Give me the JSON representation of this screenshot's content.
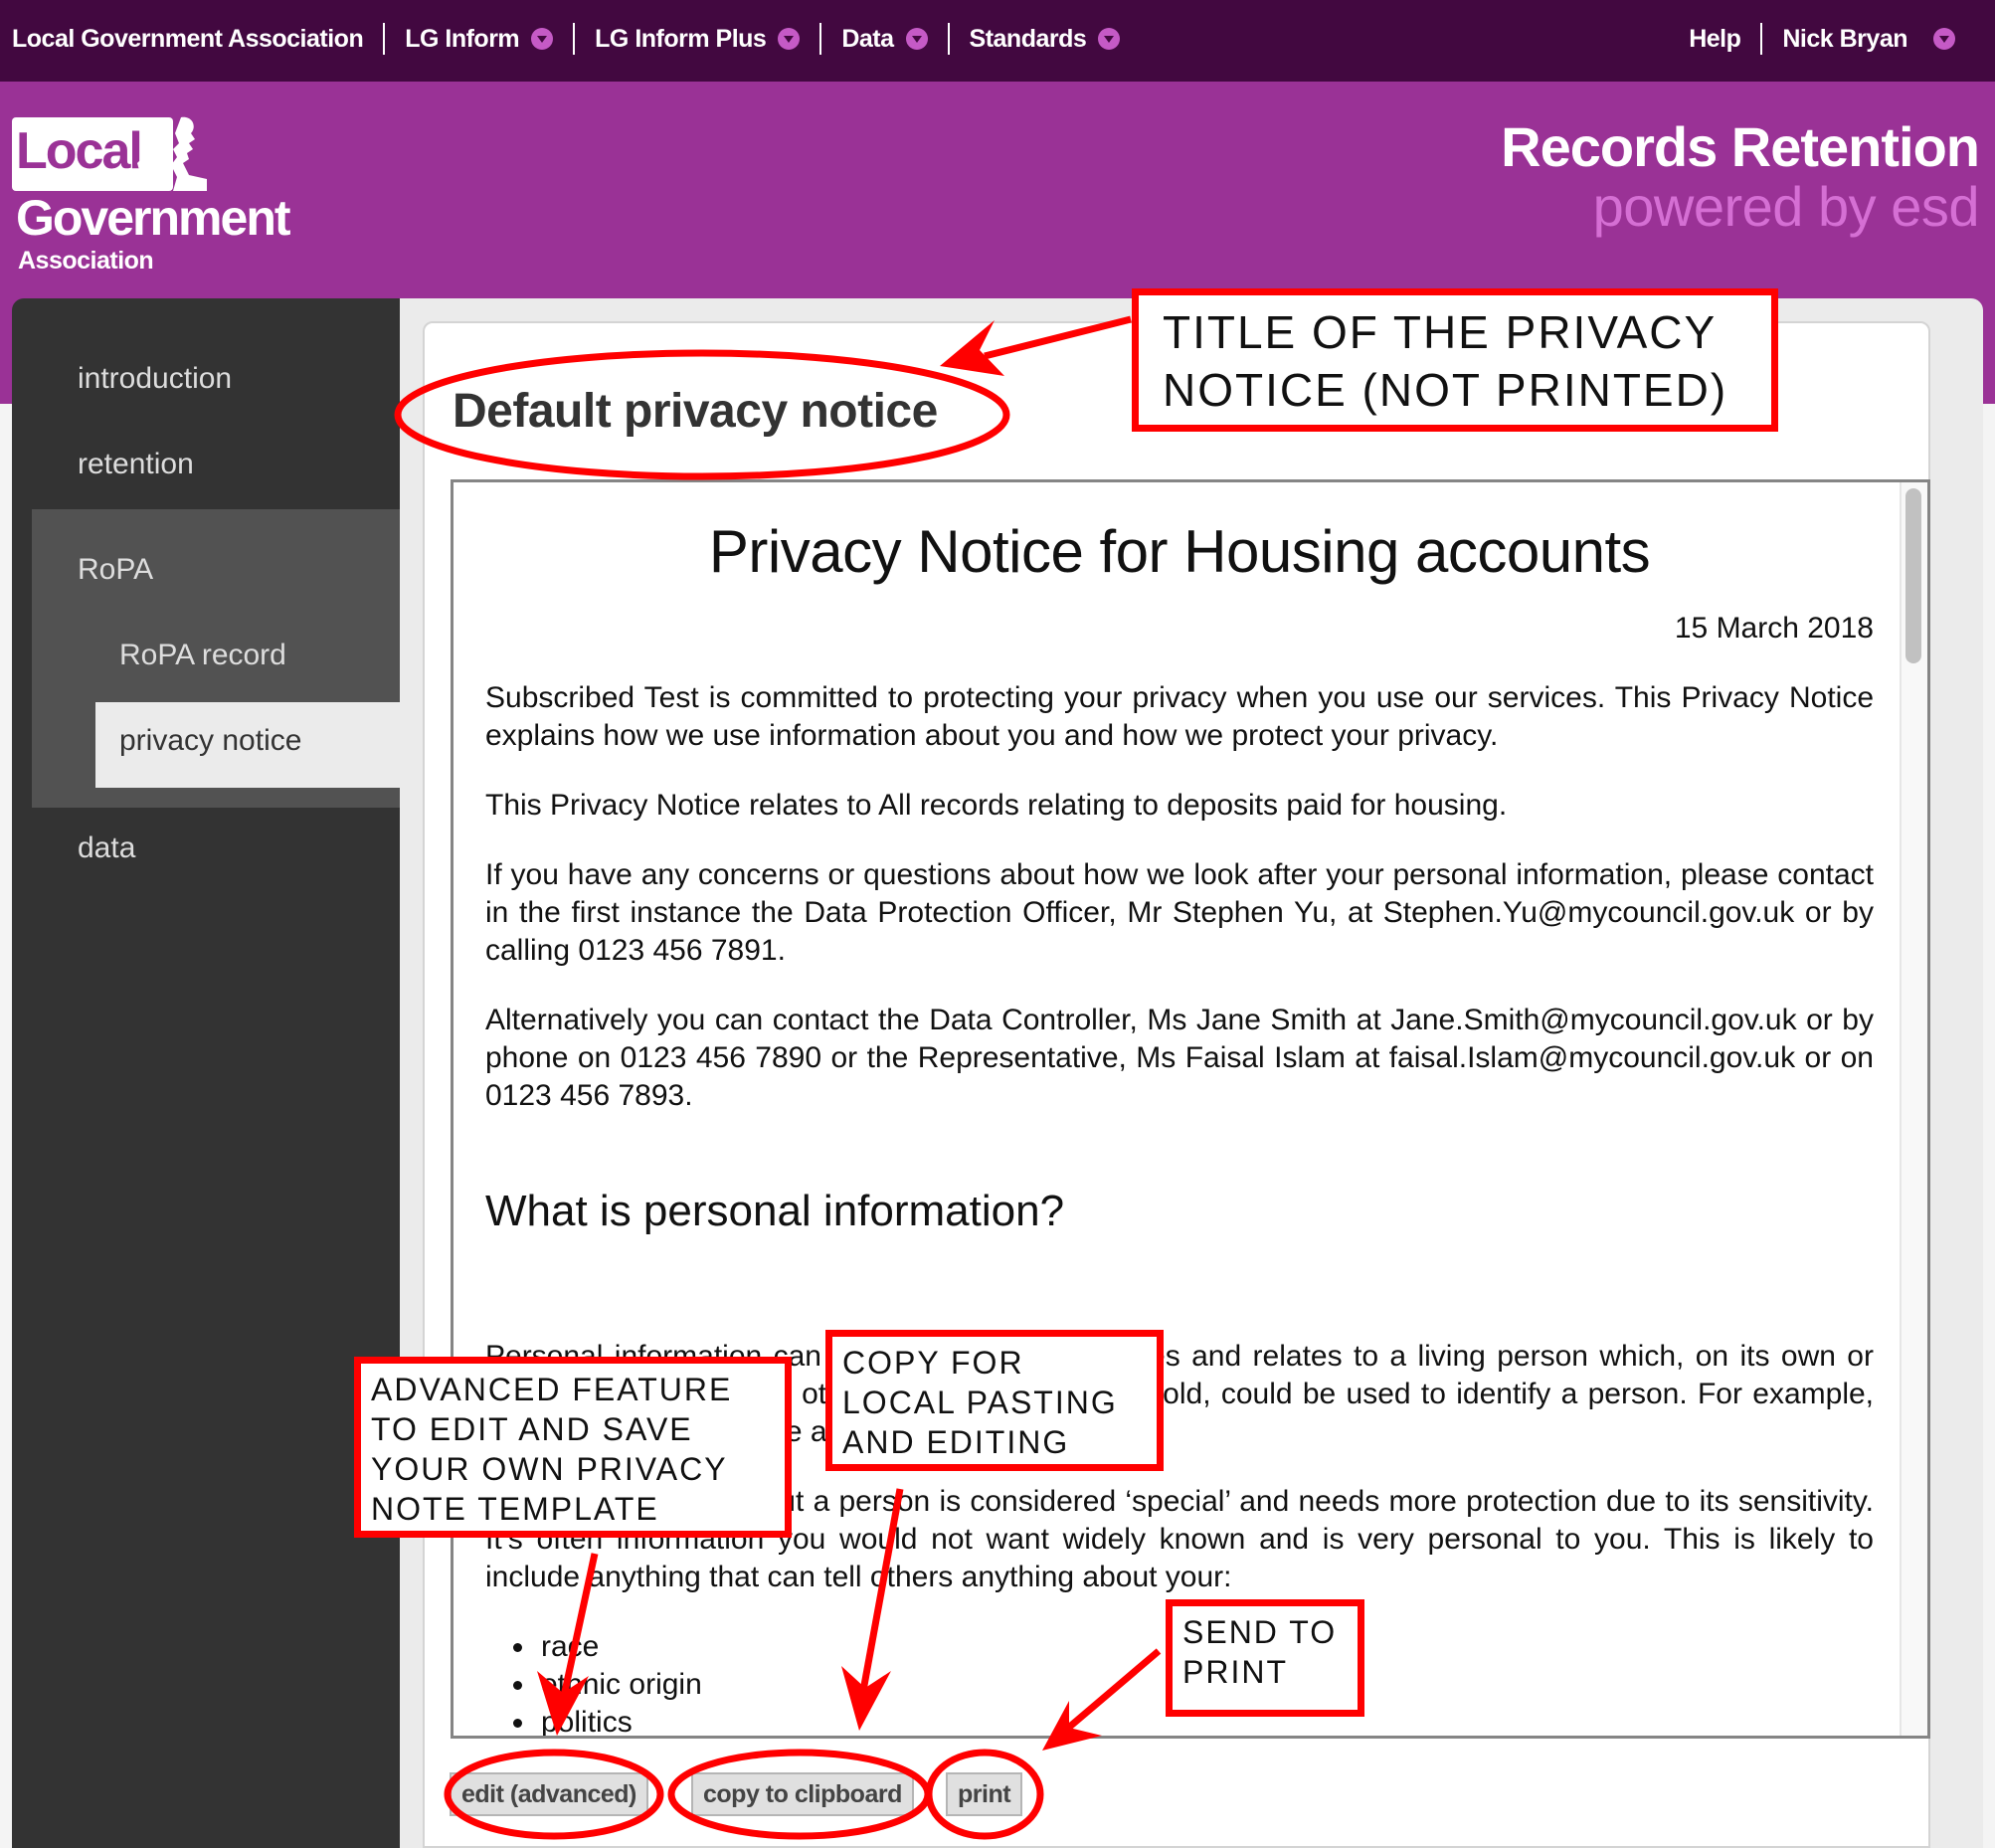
{
  "topnav": {
    "left": [
      {
        "label": "Local Government Association",
        "has_dropdown": false
      },
      {
        "label": "LG Inform",
        "has_dropdown": true
      },
      {
        "label": "LG Inform Plus",
        "has_dropdown": true
      },
      {
        "label": "Data",
        "has_dropdown": true
      },
      {
        "label": "Standards",
        "has_dropdown": true
      }
    ],
    "right": [
      {
        "label": "Help",
        "has_dropdown": false
      },
      {
        "label": "Nick Bryan",
        "has_dropdown": true
      }
    ]
  },
  "header": {
    "logo": {
      "line1": "Local",
      "line2": "Government",
      "line3": "Association"
    },
    "app_title": "Records Retention",
    "app_subtitle": "powered by esd"
  },
  "colors": {
    "topnav_bg": "#420840",
    "header_bg": "#9a3296",
    "subtitle": "#d56fd4",
    "sidebar_bg": "#333333",
    "annotation": "#ff0000"
  },
  "sidebar": {
    "items": [
      {
        "label": "introduction",
        "level": 1,
        "active": false
      },
      {
        "label": "retention",
        "level": 1,
        "active": false
      },
      {
        "label": "RoPA",
        "level": 1,
        "active": false,
        "expanded": true
      },
      {
        "label": "RoPA record",
        "level": 2,
        "active": false
      },
      {
        "label": "privacy notice",
        "level": 2,
        "active": true
      },
      {
        "label": "data",
        "level": 1,
        "active": false
      }
    ]
  },
  "main": {
    "page_title": "Default privacy notice",
    "document": {
      "title": "Privacy Notice for Housing accounts",
      "date": "15 March 2018",
      "paragraphs": [
        "Subscribed Test is committed to protecting your privacy when you use our services. This Privacy Notice explains how we use information about you and how we protect your privacy.",
        "This Privacy Notice relates to All records relating to deposits paid for housing.",
        "If you have any concerns or questions about how we look after your personal information, please contact in the first instance the Data Protection Officer, Mr Stephen Yu, at Stephen.Yu@mycouncil.gov.uk or by calling 0123 456 7891.",
        "Alternatively you can contact the Data Controller, Ms Jane Smith at Jane.Smith@mycouncil.gov.uk or by phone on 0123 456 7890 or the Representative, Ms Faisal Islam at faisal.Islam@mycouncil.gov.uk or on 0123 456 7893."
      ],
      "section_heading": "What is personal information?",
      "section_paragraphs": [
        "Personal information can be anything that identifies and relates to a living person which, on its own or when put together with other information that we hold, could be used to identify a person. For example, this could be your name and contact details.",
        "Some information about a person is considered ‘special’ and needs more protection due to its sensitivity. It’s often information you would not want widely known and is very personal to you. This is likely to include anything that can tell others anything about your:"
      ],
      "list": [
        "race",
        "ethnic origin",
        "politics"
      ]
    },
    "buttons": {
      "edit": "edit (advanced)",
      "copy": "copy to clipboard",
      "print": "print"
    }
  },
  "annotations": {
    "title_note": "TITLE OF THE PRIVACY NOTICE (NOT PRINTED)",
    "edit_note": "ADVANCED FEATURE TO EDIT AND SAVE YOUR OWN PRIVACY NOTE TEMPLATE",
    "copy_note": "COPY FOR LOCAL PASTING AND EDITING",
    "print_note": "SEND TO PRINT"
  }
}
